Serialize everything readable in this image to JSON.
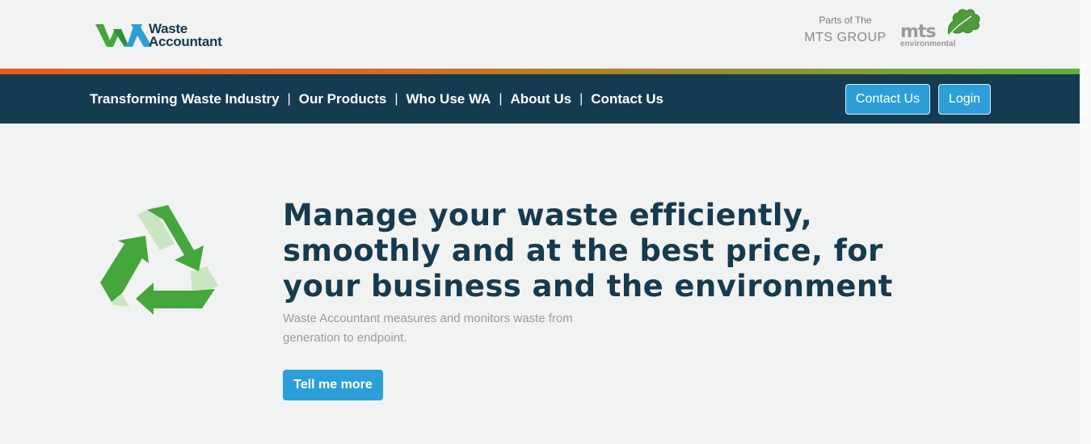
{
  "brand": {
    "logo_line1": "Waste",
    "logo_line2": "Accountant"
  },
  "group": {
    "parts_of": "Parts of The",
    "name": "MTS GROUP",
    "partner_word": "mts",
    "partner_sub": "environmental"
  },
  "nav": {
    "links": [
      {
        "label": "Transforming Waste Industry"
      },
      {
        "label": "Our Products"
      },
      {
        "label": "Who Use WA"
      },
      {
        "label": "About Us"
      },
      {
        "label": "Contact Us"
      }
    ],
    "separator": "|",
    "contact_button": "Contact Us",
    "login_button": "Login"
  },
  "hero": {
    "title_lines": [
      "Manage your waste efficiently,",
      "smoothly and at the best price, for",
      "your business and the environment"
    ],
    "subtitle_lines": [
      "Waste Accountant measures and monitors waste from",
      "generation to endpoint."
    ],
    "cta": "Tell me more",
    "icon": "recycle-icon"
  },
  "colors": {
    "navy": "#143b50",
    "accent_blue": "#2d9fd8",
    "green": "#45a63c",
    "orange": "#ef5a1f"
  }
}
